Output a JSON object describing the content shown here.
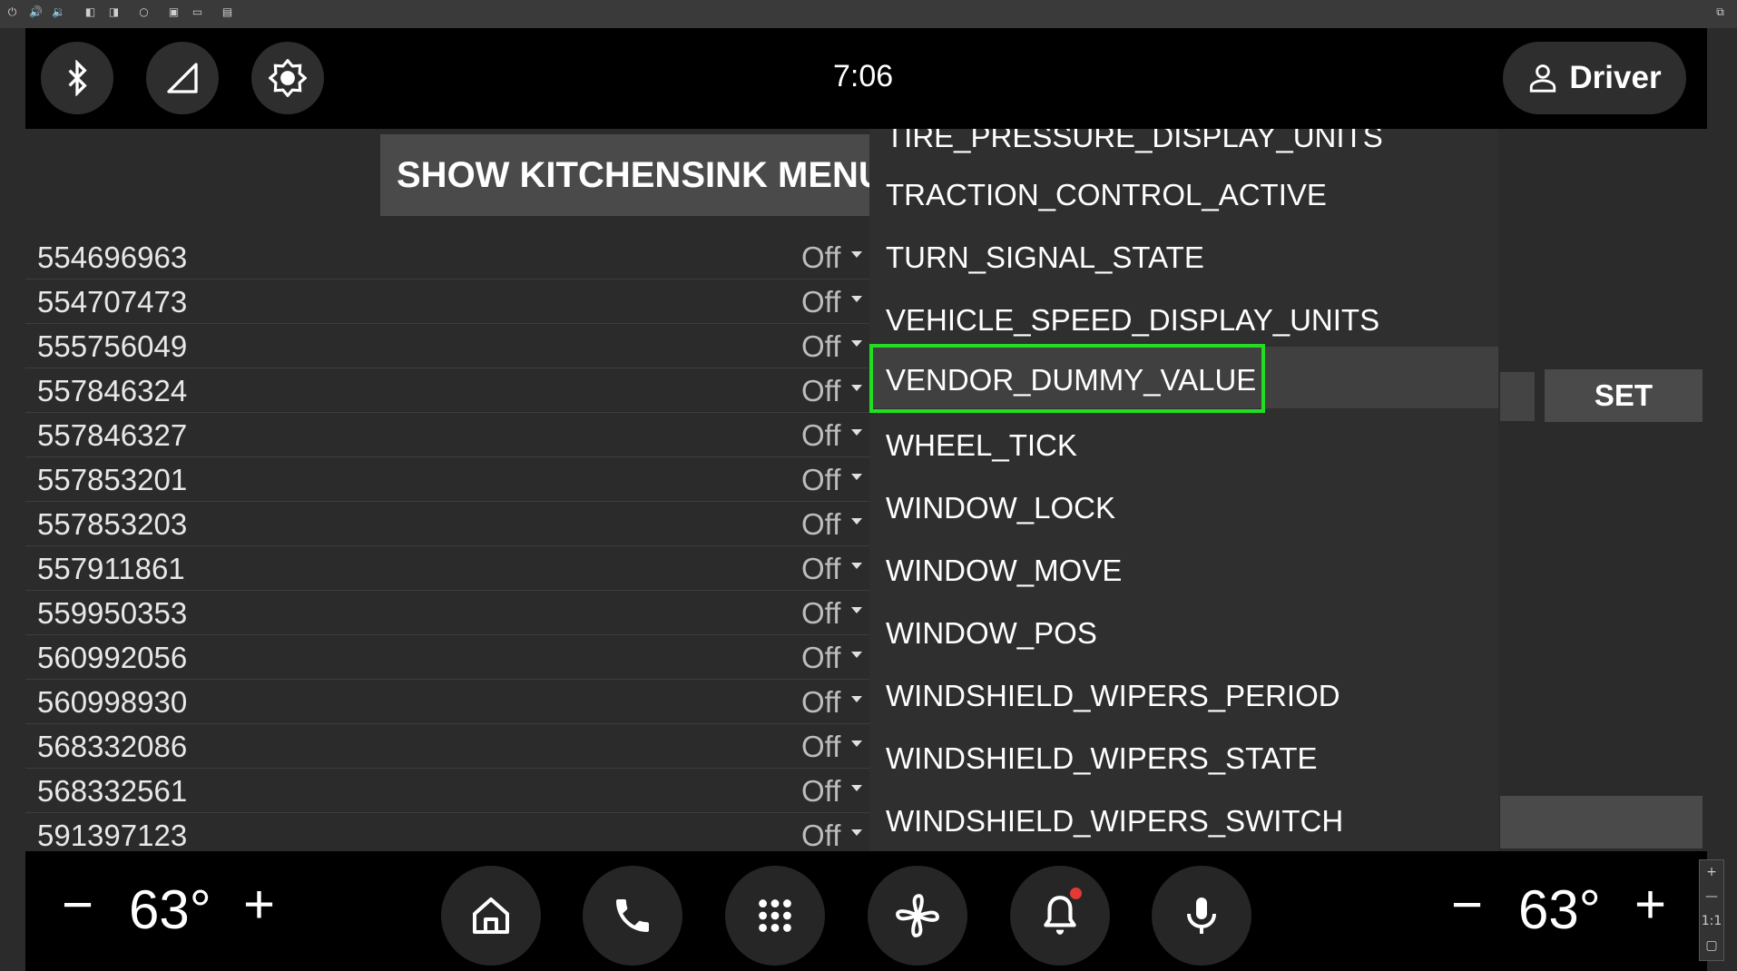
{
  "emulator": {
    "toolbar_icons": [
      "power-icon",
      "volume-up-icon",
      "volume-down-icon",
      "rotate-left-icon",
      "rotate-right-icon",
      "circle-icon",
      "camera-icon",
      "video-icon",
      "screen-record-icon",
      "resize-icon"
    ],
    "zoom_controls": [
      "+",
      "—",
      "1:1",
      "▢"
    ]
  },
  "status_bar": {
    "icons": [
      "bluetooth-icon",
      "signal-icon",
      "brightness-icon"
    ],
    "time": "7:06",
    "profile_label": "Driver"
  },
  "main": {
    "show_menu_label": "SHOW KITCHENSINK MENU",
    "properties": [
      {
        "id": "554696963",
        "value": "Off"
      },
      {
        "id": "554707473",
        "value": "Off"
      },
      {
        "id": "555756049",
        "value": "Off"
      },
      {
        "id": "557846324",
        "value": "Off"
      },
      {
        "id": "557846327",
        "value": "Off"
      },
      {
        "id": "557853201",
        "value": "Off"
      },
      {
        "id": "557853203",
        "value": "Off"
      },
      {
        "id": "557911861",
        "value": "Off"
      },
      {
        "id": "559950353",
        "value": "Off"
      },
      {
        "id": "560992056",
        "value": "Off"
      },
      {
        "id": "560998930",
        "value": "Off"
      },
      {
        "id": "568332086",
        "value": "Off"
      },
      {
        "id": "568332561",
        "value": "Off"
      },
      {
        "id": "591397123",
        "value": "Off"
      }
    ],
    "set_label": "SET"
  },
  "dropdown": {
    "items": [
      "TIRE_PRESSURE_DISPLAY_UNITS",
      "TRACTION_CONTROL_ACTIVE",
      "TURN_SIGNAL_STATE",
      "VEHICLE_SPEED_DISPLAY_UNITS",
      "VENDOR_DUMMY_VALUE",
      "WHEEL_TICK",
      "WINDOW_LOCK",
      "WINDOW_MOVE",
      "WINDOW_POS",
      "WINDSHIELD_WIPERS_PERIOD",
      "WINDSHIELD_WIPERS_STATE",
      "WINDSHIELD_WIPERS_SWITCH"
    ],
    "selected": "VENDOR_DUMMY_VALUE",
    "highlight_color": "#22dd22"
  },
  "nav_bar": {
    "left_temp": "63°",
    "right_temp": "63°",
    "minus": "−",
    "plus": "+",
    "buttons": [
      "home-icon",
      "phone-icon",
      "apps-grid-icon",
      "fan-icon",
      "notification-bell-icon",
      "microphone-icon"
    ]
  }
}
